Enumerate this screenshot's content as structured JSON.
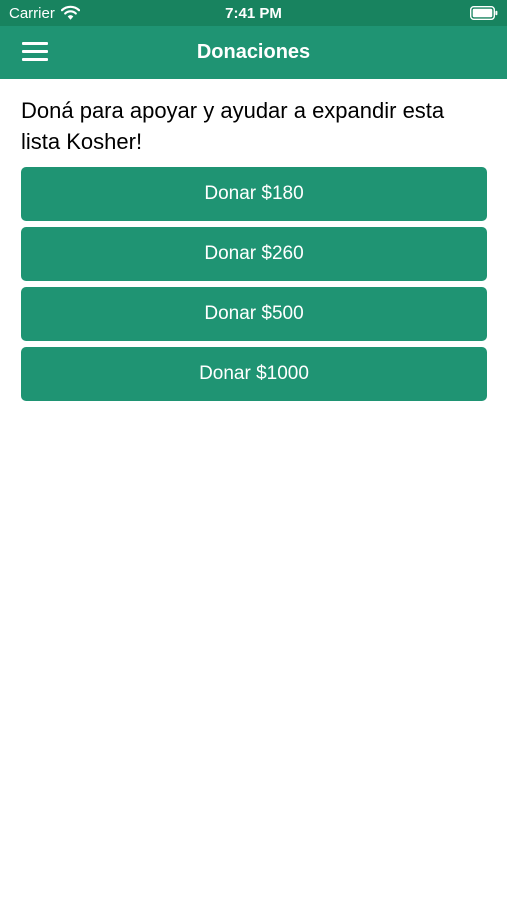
{
  "status_bar": {
    "carrier": "Carrier",
    "time": "7:41 PM",
    "wifi_icon": "wifi-icon",
    "battery_icon": "battery-icon"
  },
  "header": {
    "title": "Donaciones",
    "menu_icon": "hamburger-menu-icon"
  },
  "main": {
    "heading": "Doná para apoyar y ayudar a expandir esta lista Kosher!",
    "buttons": [
      {
        "label": "Donar $180"
      },
      {
        "label": "Donar $260"
      },
      {
        "label": "Donar $500"
      },
      {
        "label": "Donar $1000"
      }
    ]
  },
  "colors": {
    "header_background": "#1f9473",
    "status_bar_background": "#18835f",
    "button_background": "#1f9473",
    "button_text": "#ffffff",
    "heading_text": "#000000"
  }
}
